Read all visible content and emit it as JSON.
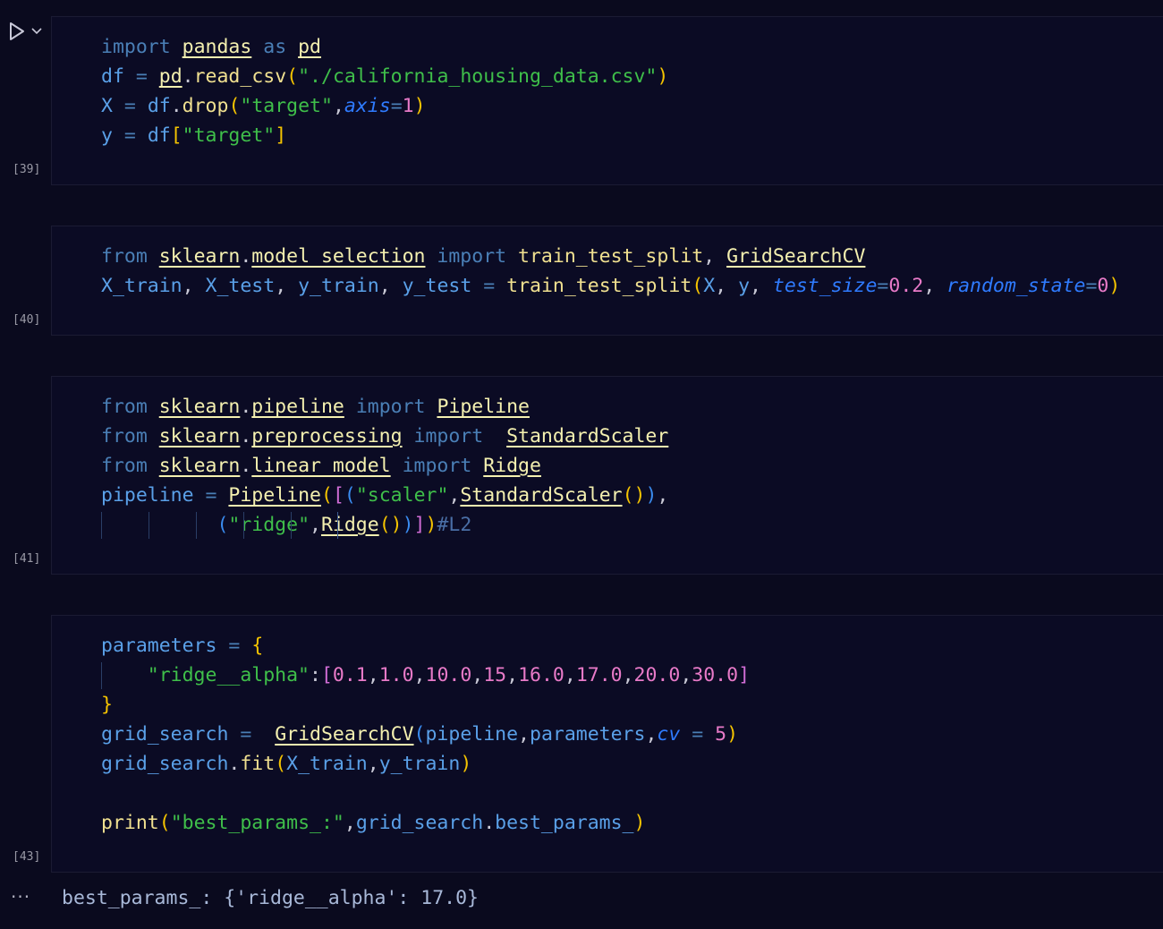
{
  "cells": [
    {
      "exec_count": "[39]",
      "lines": [
        [
          [
            "kw",
            "import"
          ],
          [
            "p",
            " "
          ],
          [
            "nm",
            "pandas"
          ],
          [
            "p",
            " "
          ],
          [
            "kw",
            "as"
          ],
          [
            "p",
            " "
          ],
          [
            "nm",
            "pd"
          ]
        ],
        [
          [
            "var",
            "df"
          ],
          [
            "p",
            " "
          ],
          [
            "op",
            "="
          ],
          [
            "p",
            " "
          ],
          [
            "nm",
            "pd"
          ],
          [
            "punc",
            "."
          ],
          [
            "fn",
            "read_csv"
          ],
          [
            "par",
            "("
          ],
          [
            "str",
            "\"./california_housing_data.csv\""
          ],
          [
            "par",
            ")"
          ]
        ],
        [
          [
            "var",
            "X"
          ],
          [
            "p",
            " "
          ],
          [
            "op",
            "="
          ],
          [
            "p",
            " "
          ],
          [
            "var",
            "df"
          ],
          [
            "punc",
            "."
          ],
          [
            "fn",
            "drop"
          ],
          [
            "par",
            "("
          ],
          [
            "str",
            "\"target\""
          ],
          [
            "punc",
            ","
          ],
          [
            "arg",
            "axis"
          ],
          [
            "op",
            "="
          ],
          [
            "num",
            "1"
          ],
          [
            "par",
            ")"
          ]
        ],
        [
          [
            "var",
            "y"
          ],
          [
            "p",
            " "
          ],
          [
            "op",
            "="
          ],
          [
            "p",
            " "
          ],
          [
            "var",
            "df"
          ],
          [
            "par",
            "["
          ],
          [
            "str",
            "\"target\""
          ],
          [
            "par",
            "]"
          ]
        ]
      ]
    },
    {
      "exec_count": "[40]",
      "lines": [
        [
          [
            "kw",
            "from"
          ],
          [
            "p",
            " "
          ],
          [
            "nm",
            "sklearn"
          ],
          [
            "punc",
            "."
          ],
          [
            "nm",
            "model_selection"
          ],
          [
            "p",
            " "
          ],
          [
            "kw",
            "import"
          ],
          [
            "p",
            " "
          ],
          [
            "fn",
            "train_test_split"
          ],
          [
            "punc",
            ","
          ],
          [
            "p",
            " "
          ],
          [
            "nm",
            "GridSearchCV"
          ]
        ],
        [
          [
            "var",
            "X_train"
          ],
          [
            "punc",
            ","
          ],
          [
            "p",
            " "
          ],
          [
            "var",
            "X_test"
          ],
          [
            "punc",
            ","
          ],
          [
            "p",
            " "
          ],
          [
            "var",
            "y_train"
          ],
          [
            "punc",
            ","
          ],
          [
            "p",
            " "
          ],
          [
            "var",
            "y_test"
          ],
          [
            "p",
            " "
          ],
          [
            "op",
            "="
          ],
          [
            "p",
            " "
          ],
          [
            "fn",
            "train_test_split"
          ],
          [
            "par",
            "("
          ],
          [
            "var",
            "X"
          ],
          [
            "punc",
            ","
          ],
          [
            "p",
            " "
          ],
          [
            "var",
            "y"
          ],
          [
            "punc",
            ","
          ],
          [
            "p",
            " "
          ],
          [
            "arg",
            "test_size"
          ],
          [
            "op",
            "="
          ],
          [
            "num",
            "0.2"
          ],
          [
            "punc",
            ","
          ],
          [
            "p",
            " "
          ],
          [
            "arg",
            "random_state"
          ],
          [
            "op",
            "="
          ],
          [
            "num",
            "0"
          ],
          [
            "par",
            ")"
          ]
        ]
      ]
    },
    {
      "exec_count": "[41]",
      "lines": [
        [
          [
            "kw",
            "from"
          ],
          [
            "p",
            " "
          ],
          [
            "nm",
            "sklearn"
          ],
          [
            "punc",
            "."
          ],
          [
            "nm",
            "pipeline"
          ],
          [
            "p",
            " "
          ],
          [
            "kw",
            "import"
          ],
          [
            "p",
            " "
          ],
          [
            "nm",
            "Pipeline"
          ]
        ],
        [
          [
            "kw",
            "from"
          ],
          [
            "p",
            " "
          ],
          [
            "nm",
            "sklearn"
          ],
          [
            "punc",
            "."
          ],
          [
            "nm",
            "preprocessing"
          ],
          [
            "p",
            " "
          ],
          [
            "kw",
            "import"
          ],
          [
            "p",
            "  "
          ],
          [
            "nm",
            "StandardScaler"
          ]
        ],
        [
          [
            "kw",
            "from"
          ],
          [
            "p",
            " "
          ],
          [
            "nm",
            "sklearn"
          ],
          [
            "punc",
            "."
          ],
          [
            "nm",
            "linear_model"
          ],
          [
            "p",
            " "
          ],
          [
            "kw",
            "import"
          ],
          [
            "p",
            " "
          ],
          [
            "nm",
            "Ridge"
          ]
        ],
        [
          [
            "var",
            "pipeline"
          ],
          [
            "p",
            " "
          ],
          [
            "op",
            "="
          ],
          [
            "p",
            " "
          ],
          [
            "nm",
            "Pipeline"
          ],
          [
            "par",
            "("
          ],
          [
            "brk",
            "["
          ],
          [
            "br3",
            "("
          ],
          [
            "str",
            "\"scaler\""
          ],
          [
            "punc",
            ","
          ],
          [
            "nm",
            "StandardScaler"
          ],
          [
            "par",
            "()"
          ],
          [
            "br3",
            ")"
          ],
          [
            "punc",
            ","
          ]
        ],
        [
          [
            "p",
            "          "
          ],
          [
            "br3",
            "("
          ],
          [
            "str",
            "\"ridge\""
          ],
          [
            "punc",
            ","
          ],
          [
            "nm",
            "Ridge"
          ],
          [
            "par",
            "()"
          ],
          [
            "br3",
            ")"
          ],
          [
            "brk",
            "]"
          ],
          [
            "par",
            ")"
          ],
          [
            "cmt",
            "#L2"
          ]
        ]
      ]
    },
    {
      "exec_count": "[43]",
      "lines": [
        [
          [
            "var",
            "parameters"
          ],
          [
            "p",
            " "
          ],
          [
            "op",
            "="
          ],
          [
            "p",
            " "
          ],
          [
            "par",
            "{"
          ]
        ],
        [
          [
            "p",
            "    "
          ],
          [
            "str",
            "\"ridge__alpha\""
          ],
          [
            "punc",
            ":"
          ],
          [
            "brk",
            "["
          ],
          [
            "num",
            "0.1"
          ],
          [
            "punc",
            ","
          ],
          [
            "num",
            "1.0"
          ],
          [
            "punc",
            ","
          ],
          [
            "num",
            "10.0"
          ],
          [
            "punc",
            ","
          ],
          [
            "num",
            "15"
          ],
          [
            "punc",
            ","
          ],
          [
            "num",
            "16.0"
          ],
          [
            "punc",
            ","
          ],
          [
            "num",
            "17.0"
          ],
          [
            "punc",
            ","
          ],
          [
            "num",
            "20.0"
          ],
          [
            "punc",
            ","
          ],
          [
            "num",
            "30.0"
          ],
          [
            "brk",
            "]"
          ]
        ],
        [
          [
            "par",
            "}"
          ]
        ],
        [
          [
            "var",
            "grid_search"
          ],
          [
            "p",
            " "
          ],
          [
            "op",
            "="
          ],
          [
            "p",
            "  "
          ],
          [
            "nm",
            "GridSearchCV"
          ],
          [
            "br3",
            "("
          ],
          [
            "var",
            "pipeline"
          ],
          [
            "punc",
            ","
          ],
          [
            "var",
            "parameters"
          ],
          [
            "punc",
            ","
          ],
          [
            "arg",
            "cv"
          ],
          [
            "p",
            " "
          ],
          [
            "op",
            "="
          ],
          [
            "p",
            " "
          ],
          [
            "num",
            "5"
          ],
          [
            "par",
            ")"
          ]
        ],
        [
          [
            "var",
            "grid_search"
          ],
          [
            "punc",
            "."
          ],
          [
            "fn",
            "fit"
          ],
          [
            "par",
            "("
          ],
          [
            "var",
            "X_train"
          ],
          [
            "punc",
            ","
          ],
          [
            "var",
            "y_train"
          ],
          [
            "par",
            ")"
          ]
        ],
        [],
        [
          [
            "fn",
            "print"
          ],
          [
            "par",
            "("
          ],
          [
            "str",
            "\"best_params_:\""
          ],
          [
            "punc",
            ","
          ],
          [
            "var",
            "grid_search"
          ],
          [
            "punc",
            "."
          ],
          [
            "var",
            "best_params_"
          ],
          [
            "par",
            ")"
          ]
        ]
      ]
    }
  ],
  "output": {
    "text": "best_params_: {'ridge__alpha': 17.0}"
  },
  "icons": {
    "run": "run-triangle-icon",
    "run_menu": "chevron-down-icon",
    "more": "ellipsis-icon"
  }
}
